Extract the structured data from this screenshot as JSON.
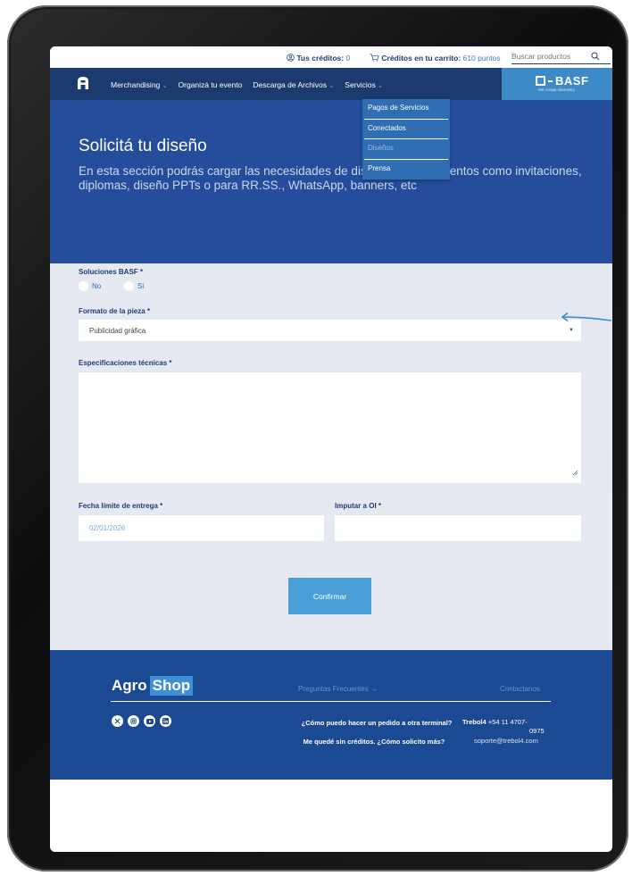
{
  "utilbar": {
    "credits_label": "Tus créditos:",
    "credits_value": "0",
    "cart_label": "Créditos en tu carrito:",
    "cart_value": "610 puntos",
    "search_placeholder": "Buscar productos"
  },
  "nav": {
    "items": [
      "Merchandising",
      "Organizá tu evento",
      "Descarga de Archivos",
      "Servicios"
    ]
  },
  "basf": {
    "logo": "BASF",
    "tagline": "We create chemistry"
  },
  "dropdown": {
    "items": [
      "Pagos de Servicios",
      "Conectados",
      "Diseños",
      "Prensa"
    ]
  },
  "hero": {
    "title": "Solicitá tu diseño",
    "description": "En esta sección podrás cargar las necesidades de diseño para tus eventos como invitaciones, diplomas, diseño PPTs o para RR.SS., WhatsApp, banners, etc"
  },
  "form": {
    "soluciones_label": "Soluciones BASF *",
    "radio_no": "No",
    "radio_si": "Si",
    "formato_label": "Formato de la pieza *",
    "formato_value": "Publicidad gráfica",
    "especificaciones_label": "Especificaciones técnicas *",
    "fecha_label": "Fecha límite de entrega *",
    "fecha_value": "02/01/2026",
    "imputar_label": "Imputar a OI *",
    "confirm_label": "Confirmar"
  },
  "footer": {
    "brand_agro": "Agro",
    "brand_shop": "Shop",
    "faq_link": "Preguntas Frecuentes →",
    "contact_link": "Contactanos",
    "faq_q1": "¿Cómo puedo hacer un pedido a otra terminal?",
    "faq_q2": "Me quedé sin créditos. ¿Cómo solicito más?",
    "trebol_name": "Trebol4",
    "trebol_phone": "+54 11 4707-",
    "trebol_phone_cont": "0975",
    "email": "soporte@trebol4.com"
  },
  "colors": {
    "nav_bg": "#1b3a6e",
    "hero_bg": "#254d9b",
    "accent": "#4aa0d6",
    "form_bg": "#e5e9f2",
    "footer_bg": "#1b4a93"
  }
}
